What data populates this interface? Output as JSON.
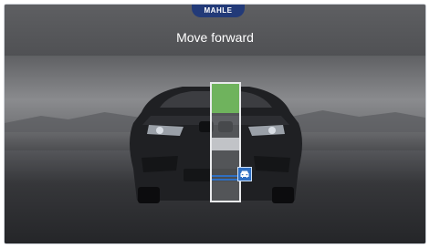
{
  "brand": {
    "logo_text": "MAHLE"
  },
  "header": {
    "title": "Move forward"
  },
  "gauge": {
    "target_zone_label": "target",
    "vehicle_icon": "car-front-icon"
  },
  "colors": {
    "brand_blue": "#223a78",
    "target_green": "#6fb35d",
    "indicator_blue": "#2f6fc3"
  }
}
